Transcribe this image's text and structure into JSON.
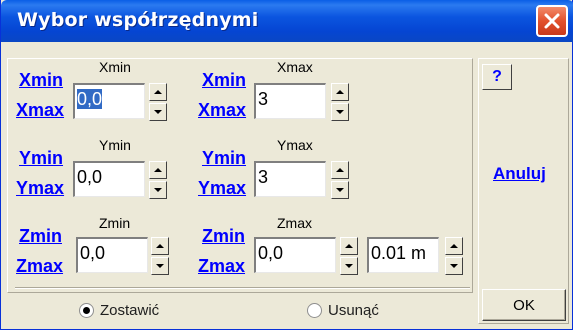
{
  "window": {
    "title": "Wybor współrzędnymi"
  },
  "x": {
    "min_link_top": "Xmin",
    "min_link_bottom": "Xmax",
    "min_caption": "Xmin",
    "min_value": "0,0",
    "max_link_top": "Xmin",
    "max_link_bottom": "Xmax",
    "max_caption": "Xmax",
    "max_value": "3"
  },
  "y": {
    "min_link_top": "Ymin",
    "min_link_bottom": "Ymax",
    "min_caption": "Ymin",
    "min_value": "0,0",
    "max_link_top": "Ymin",
    "max_link_bottom": "Ymax",
    "max_caption": "Ymax",
    "max_value": "3"
  },
  "z": {
    "min_link_top": "Zmin",
    "min_link_bottom": "Zmax",
    "min_caption": "Zmin",
    "min_value": "0,0",
    "max_link_top": "Zmin",
    "max_link_bottom": "Zmax",
    "max_caption": "Zmax",
    "max_value": "0,0"
  },
  "step": {
    "value": "0.01 m"
  },
  "options": {
    "keep_label": "Zostawić",
    "keep_selected": true,
    "remove_label": "Usunąć",
    "remove_selected": false
  },
  "side": {
    "help_label": "?",
    "cancel_label": "Anuluj",
    "ok_label": "OK"
  },
  "colors": {
    "title_bar": "#0a5ee6",
    "link": "#0000ff",
    "selection": "#316ac5",
    "close": "#e2512d"
  }
}
